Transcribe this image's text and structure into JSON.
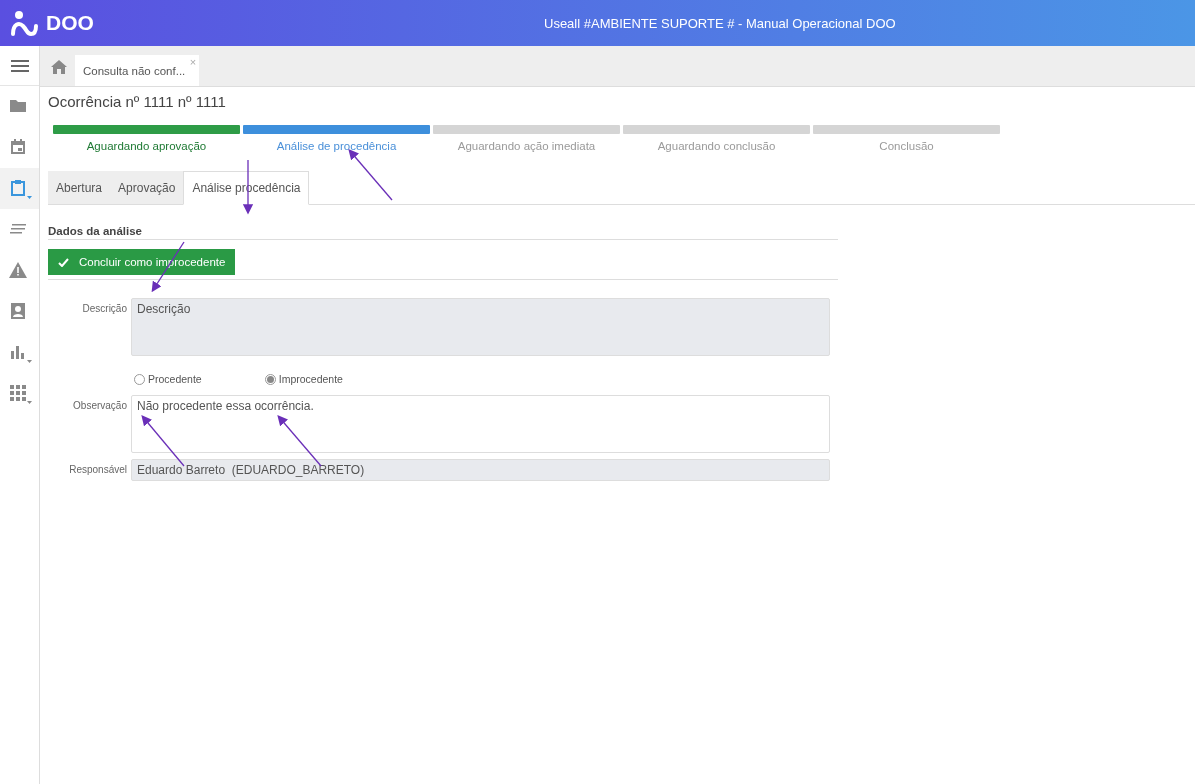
{
  "header": {
    "brand": "DOO",
    "title": "Useall #AMBIENTE SUPORTE # - Manual Operacional DOO"
  },
  "sidebar": {
    "items": [
      {
        "kind": "folder",
        "selected": false
      },
      {
        "kind": "calendar",
        "selected": false
      },
      {
        "kind": "clipboard",
        "selected": true
      },
      {
        "kind": "lines",
        "selected": false
      },
      {
        "kind": "warning",
        "selected": false
      },
      {
        "kind": "contact",
        "selected": false
      },
      {
        "kind": "chart",
        "selected": false
      },
      {
        "kind": "grid",
        "selected": false
      }
    ]
  },
  "open_tabs": [
    {
      "label": "Consulta não conf...",
      "close": "×"
    }
  ],
  "page_title": "Ocorrência nº 1111 nº 1111",
  "steps": [
    {
      "label": "Aguardando aprovação",
      "completed": true,
      "selected": false
    },
    {
      "label": "Análise de procedência",
      "completed": false,
      "selected": true
    },
    {
      "label": "Aguardando ação imediata",
      "completed": false,
      "selected": false
    },
    {
      "label": "Aguardando conclusão",
      "completed": false,
      "selected": false
    },
    {
      "label": "Conclusão",
      "completed": false,
      "selected": false
    }
  ],
  "tabs": [
    {
      "label": "Abertura",
      "selected": false
    },
    {
      "label": "Aprovação",
      "selected": false
    },
    {
      "label": "Análise procedência",
      "selected": true
    }
  ],
  "section_title": "Dados da análise",
  "action_button": "Concluir como improcedente",
  "form": {
    "description": {
      "label": "Descrição",
      "placeholder": "Descrição"
    },
    "options": [
      {
        "label": "Procedente",
        "selected": false
      },
      {
        "label": "Improcedente",
        "selected": true
      }
    ],
    "observation": {
      "label": "Observação",
      "value": "Não procedente essa ocorrência."
    },
    "responsible": {
      "label": "Responsável",
      "value": "Eduardo Barreto  (EDUARDO_BARRETO)"
    }
  }
}
